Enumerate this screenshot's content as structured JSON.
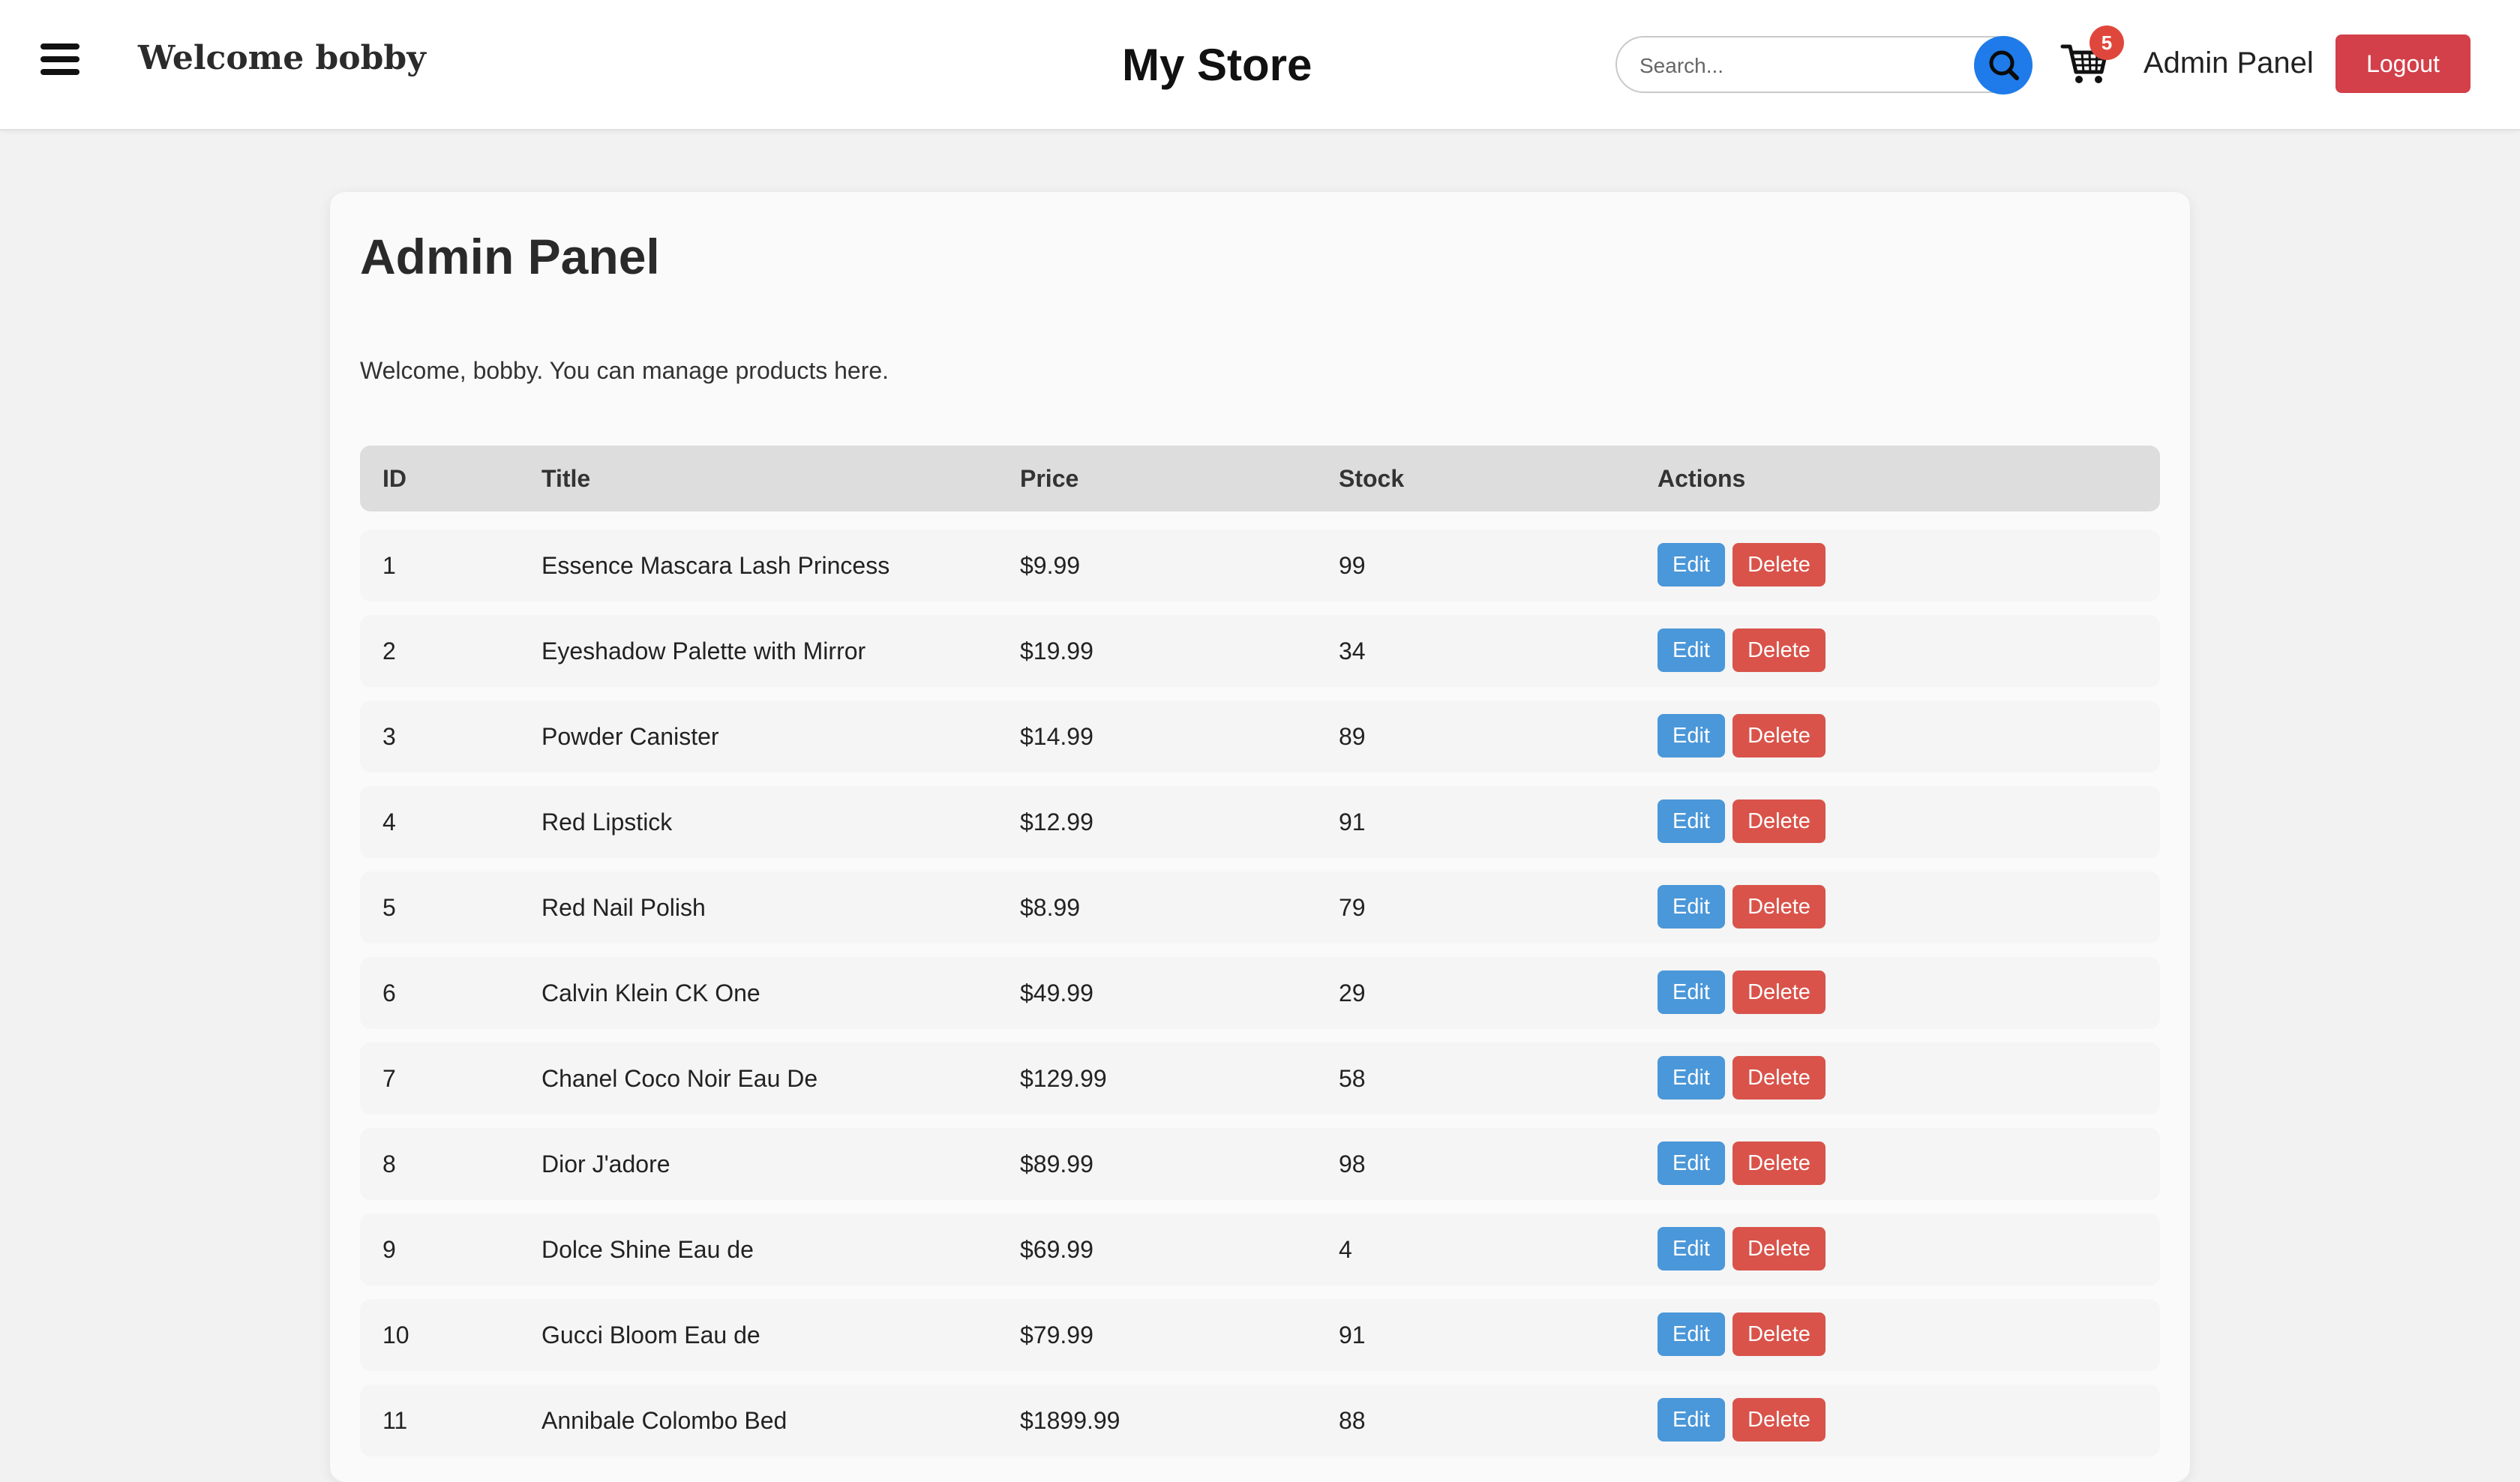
{
  "header": {
    "welcome_text": "Welcome bobby",
    "store_title": "My Store",
    "search_placeholder": "Search...",
    "cart_count": "5",
    "admin_link": "Admin Panel",
    "logout_label": "Logout"
  },
  "main": {
    "title": "Admin Panel",
    "intro": "Welcome, bobby. You can manage products here.",
    "columns": [
      "ID",
      "Title",
      "Price",
      "Stock",
      "Actions"
    ],
    "edit_label": "Edit",
    "delete_label": "Delete",
    "rows": [
      {
        "id": "1",
        "title": "Essence Mascara Lash Princess",
        "price": "$9.99",
        "stock": "99"
      },
      {
        "id": "2",
        "title": "Eyeshadow Palette with Mirror",
        "price": "$19.99",
        "stock": "34"
      },
      {
        "id": "3",
        "title": "Powder Canister",
        "price": "$14.99",
        "stock": "89"
      },
      {
        "id": "4",
        "title": "Red Lipstick",
        "price": "$12.99",
        "stock": "91"
      },
      {
        "id": "5",
        "title": "Red Nail Polish",
        "price": "$8.99",
        "stock": "79"
      },
      {
        "id": "6",
        "title": "Calvin Klein CK One",
        "price": "$49.99",
        "stock": "29"
      },
      {
        "id": "7",
        "title": "Chanel Coco Noir Eau De",
        "price": "$129.99",
        "stock": "58"
      },
      {
        "id": "8",
        "title": "Dior J'adore",
        "price": "$89.99",
        "stock": "98"
      },
      {
        "id": "9",
        "title": "Dolce Shine Eau de",
        "price": "$69.99",
        "stock": "4"
      },
      {
        "id": "10",
        "title": "Gucci Bloom Eau de",
        "price": "$79.99",
        "stock": "91"
      },
      {
        "id": "11",
        "title": "Annibale Colombo Bed",
        "price": "$1899.99",
        "stock": "88"
      }
    ]
  },
  "icons": {
    "menu": "hamburger-menu-icon",
    "search": "search-icon",
    "cart": "shopping-cart-icon"
  },
  "colors": {
    "primary_blue": "#1e7be9",
    "logout_red": "#d3404a",
    "badge_red": "#e0473c",
    "edit_blue": "#4a97d9",
    "delete_red": "#d9534a"
  }
}
